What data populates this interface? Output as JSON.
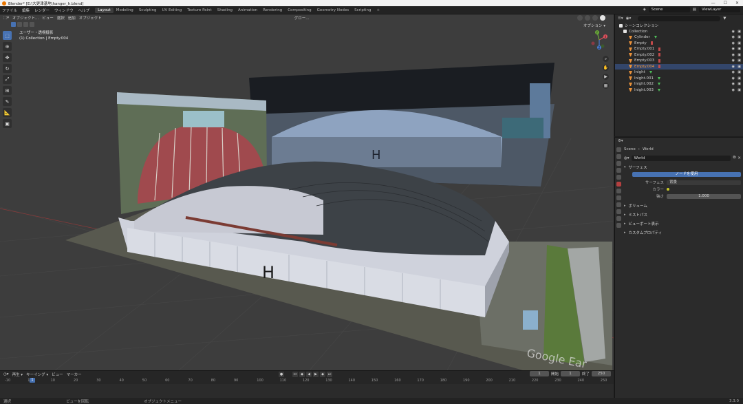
{
  "titlebar": {
    "title": "Blender* [E:\\大更津基地\\hanger_h.blend]",
    "min": "—",
    "max": "☐",
    "close": "✕"
  },
  "menu": [
    "ファイル",
    "編集",
    "レンダー",
    "ウィンドウ",
    "ヘルプ"
  ],
  "workspaces": [
    "Layout",
    "Modeling",
    "Sculpting",
    "UV Editing",
    "Texture Paint",
    "Shading",
    "Animation",
    "Rendering",
    "Compositing",
    "Geometry Nodes",
    "Scripting",
    "+"
  ],
  "active_workspace": "Layout",
  "scene_field": "Scene",
  "viewlayer_field": "ViewLayer",
  "viewport": {
    "header_items": [
      "オブジェクト...",
      "ビュー",
      "選択",
      "追加",
      "オブジェクト"
    ],
    "orientation": "グロー...",
    "view_name": "ユーザー・透視投影",
    "selection_info": "(1) Collection | Empty.004",
    "options_label": "オプション ▾",
    "hangar_letter": "H",
    "watermark": "Google Ear"
  },
  "gizmo": {
    "x": "X",
    "y": "Y",
    "z": "Z"
  },
  "timeline": {
    "header_items": [
      "再生 ▾",
      "キーイング ▾",
      "ビュー",
      "マーカー"
    ],
    "current_frame": "1",
    "start_label": "開始",
    "start": "1",
    "end_label": "終了",
    "end": "250",
    "ticks": [
      "-10",
      "1",
      "10",
      "20",
      "30",
      "40",
      "50",
      "60",
      "70",
      "80",
      "90",
      "100",
      "110",
      "120",
      "130",
      "140",
      "150",
      "160",
      "170",
      "180",
      "190",
      "200",
      "210",
      "220",
      "230",
      "240",
      "250"
    ]
  },
  "statusbar": {
    "left": "選択",
    "middle": "ビューを回転",
    "right": "オブジェクトメニュー",
    "version": "3.3.0"
  },
  "outliner": {
    "root": "シーンコレクション",
    "collection": "Collection",
    "items": [
      {
        "name": "Cylinder",
        "extra": "green",
        "selected": false
      },
      {
        "name": "Empty",
        "extra": "red",
        "selected": false
      },
      {
        "name": "Empty.001",
        "extra": "red",
        "selected": false
      },
      {
        "name": "Empty.002",
        "extra": "red",
        "selected": false
      },
      {
        "name": "Empty.003",
        "extra": "red",
        "selected": false
      },
      {
        "name": "Empty.004",
        "extra": "red",
        "selected": true
      },
      {
        "name": "Inight",
        "extra": "green",
        "selected": false
      },
      {
        "name": "Inight.001",
        "extra": "green",
        "selected": false
      },
      {
        "name": "Inight.002",
        "extra": "green",
        "selected": false
      },
      {
        "name": "Inight.003",
        "extra": "green",
        "selected": false
      }
    ]
  },
  "properties": {
    "breadcrumb_scene": "Scene",
    "breadcrumb_sep": "›",
    "breadcrumb_world": "World",
    "world_name": "World",
    "panels": {
      "surface": "サーフェス",
      "volume": "ボリューム",
      "mist": "ミストパス",
      "viewport_display": "ビューポート表示",
      "custom_props": "カスタムプロパティ"
    },
    "use_nodes": "ノードを使用",
    "surface_label": "サーフェス",
    "surface_value": "背景",
    "color_label": "カラー",
    "strength_label": "強さ",
    "strength_value": "1.000"
  },
  "colors": {
    "accent": "#4772b3",
    "selected_text": "#ff9d3c",
    "viewport_bg": "#3d3d3d"
  }
}
